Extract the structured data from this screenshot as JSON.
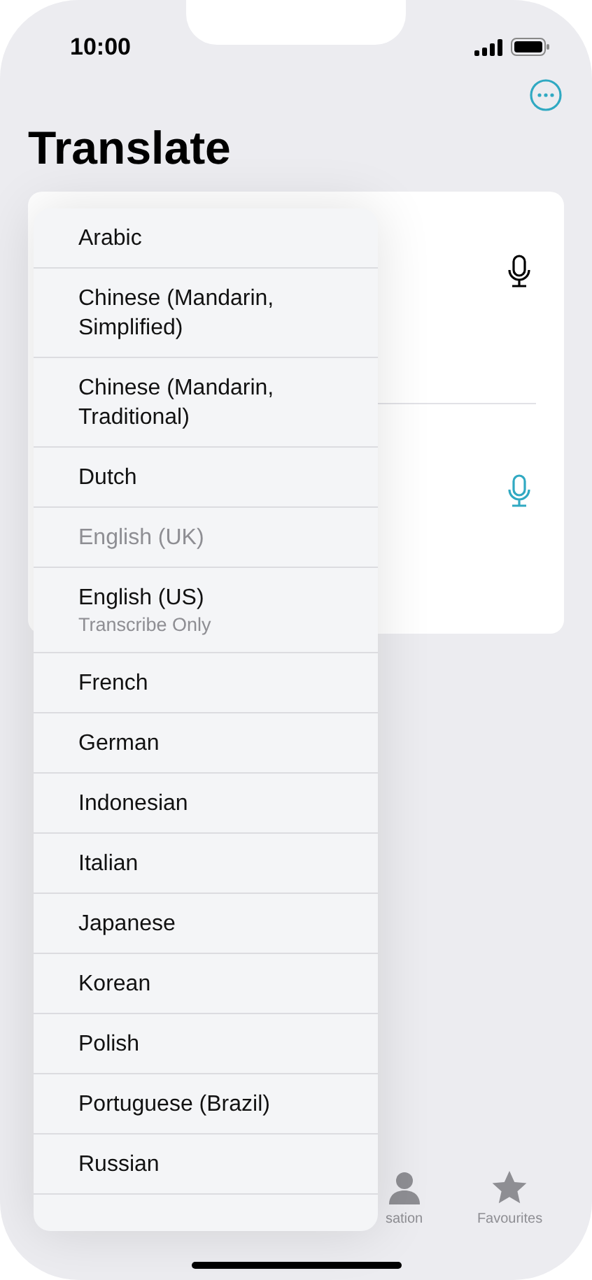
{
  "status_bar": {
    "time": "10:00"
  },
  "title": "Translate",
  "translate_card": {
    "mics": [
      {
        "active": false
      },
      {
        "active": true
      }
    ]
  },
  "language_menu": {
    "items": [
      {
        "label": "Arabic",
        "disabled": false
      },
      {
        "label": "Chinese (Mandarin, Simplified)",
        "disabled": false
      },
      {
        "label": "Chinese (Mandarin, Traditional)",
        "disabled": false
      },
      {
        "label": "Dutch",
        "disabled": false
      },
      {
        "label": "English (UK)",
        "disabled": true
      },
      {
        "label": "English (US)",
        "subtitle": "Transcribe Only",
        "disabled": false
      },
      {
        "label": "French",
        "disabled": false
      },
      {
        "label": "German",
        "disabled": false
      },
      {
        "label": "Indonesian",
        "disabled": false
      },
      {
        "label": "Italian",
        "disabled": false
      },
      {
        "label": "Japanese",
        "disabled": false
      },
      {
        "label": "Korean",
        "disabled": false
      },
      {
        "label": "Polish",
        "disabled": false
      },
      {
        "label": "Portuguese (Brazil)",
        "disabled": false
      },
      {
        "label": "Russian",
        "disabled": false
      }
    ]
  },
  "tab_bar": {
    "tabs": [
      {
        "kind": "person",
        "label": "sation"
      },
      {
        "kind": "star",
        "label": "Favourites"
      }
    ]
  }
}
